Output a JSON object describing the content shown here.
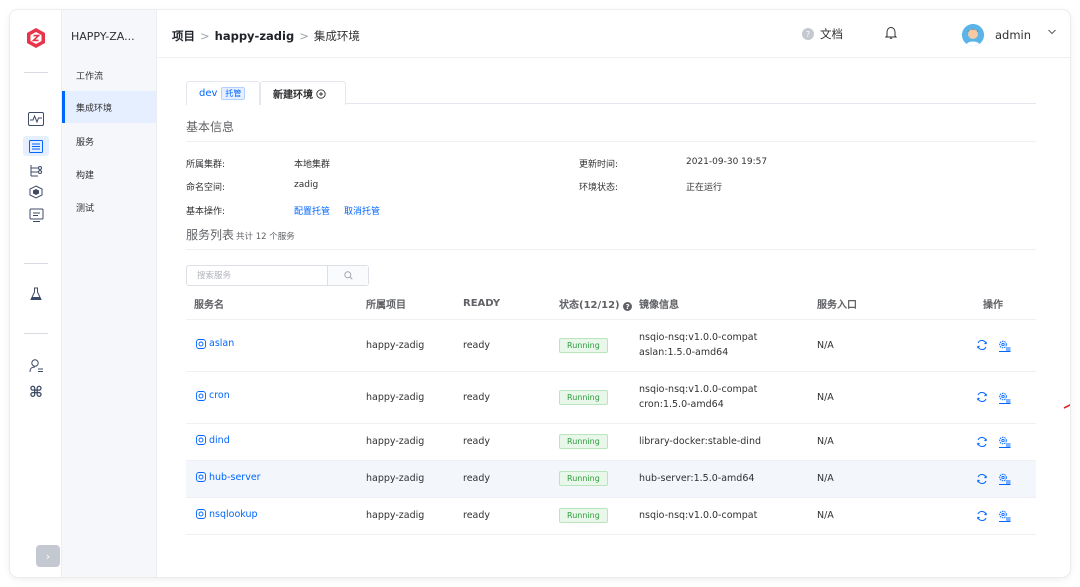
{
  "rail": {
    "logo_icon": "zadig-logo-icon",
    "items": [
      {
        "icon": "activity-icon",
        "active": false
      },
      {
        "icon": "project-list-icon",
        "active": true
      },
      {
        "icon": "workflow-tree-icon",
        "active": false
      },
      {
        "icon": "cube-icon",
        "active": false
      },
      {
        "icon": "monitor-icon",
        "active": false
      },
      {
        "icon": "flask-icon",
        "active": false
      },
      {
        "icon": "user-settings-icon",
        "active": false
      },
      {
        "icon": "command-icon",
        "active": false
      }
    ],
    "expand_icon": "chevron-right-icon"
  },
  "sidebar": {
    "project_name": "HAPPY-ZA...",
    "items": [
      {
        "label": "工作流",
        "active": false
      },
      {
        "label": "集成环境",
        "active": true
      },
      {
        "label": "服务",
        "active": false
      },
      {
        "label": "构建",
        "active": false
      },
      {
        "label": "测试",
        "active": false
      }
    ]
  },
  "header": {
    "crumb_root": "项目",
    "crumb_project": "happy-zadig",
    "crumb_page": "集成环境",
    "docs": "文档",
    "user": "admin"
  },
  "tabs": {
    "env_name": "dev",
    "env_tag": "托管",
    "new_env": "新建环境"
  },
  "basic_info": {
    "title": "基本信息",
    "cluster_label": "所属集群:",
    "cluster_value": "本地集群",
    "ns_label": "命名空间:",
    "ns_value": "zadig",
    "ops_label": "基本操作:",
    "op_config": "配置托管",
    "op_cancel": "取消托管",
    "updated_label": "更新时间:",
    "updated_value": "2021-09-30 19:57",
    "status_label": "环境状态:",
    "status_value": "正在运行"
  },
  "services": {
    "title": "服务列表",
    "count_text": "共计 12 个服务",
    "search_placeholder": "搜索服务",
    "columns": {
      "name": "服务名",
      "project": "所属项目",
      "ready": "READY",
      "status": "状态(12/12)",
      "image": "镜像信息",
      "entry": "服务入口",
      "ops": "操作"
    },
    "rows": [
      {
        "name": "aslan",
        "project": "happy-zadig",
        "ready": "ready",
        "status": "Running",
        "images": [
          "nsqio-nsq:v1.0.0-compat",
          "aslan:1.5.0-amd64"
        ],
        "entry": "N/A"
      },
      {
        "name": "cron",
        "project": "happy-zadig",
        "ready": "ready",
        "status": "Running",
        "images": [
          "nsqio-nsq:v1.0.0-compat",
          "cron:1.5.0-amd64"
        ],
        "entry": "N/A"
      },
      {
        "name": "dind",
        "project": "happy-zadig",
        "ready": "ready",
        "status": "Running",
        "images": [
          "library-docker:stable-dind"
        ],
        "entry": "N/A"
      },
      {
        "name": "hub-server",
        "project": "happy-zadig",
        "ready": "ready",
        "status": "Running",
        "images": [
          "hub-server:1.5.0-amd64"
        ],
        "entry": "N/A"
      },
      {
        "name": "nsqlookup",
        "project": "happy-zadig",
        "ready": "ready",
        "status": "Running",
        "images": [
          "nsqio-nsq:v1.0.0-compat"
        ],
        "entry": "N/A"
      }
    ]
  },
  "colors": {
    "accent": "#0066ff",
    "running": "#2e9c3c",
    "arrow": "#d9232d"
  }
}
